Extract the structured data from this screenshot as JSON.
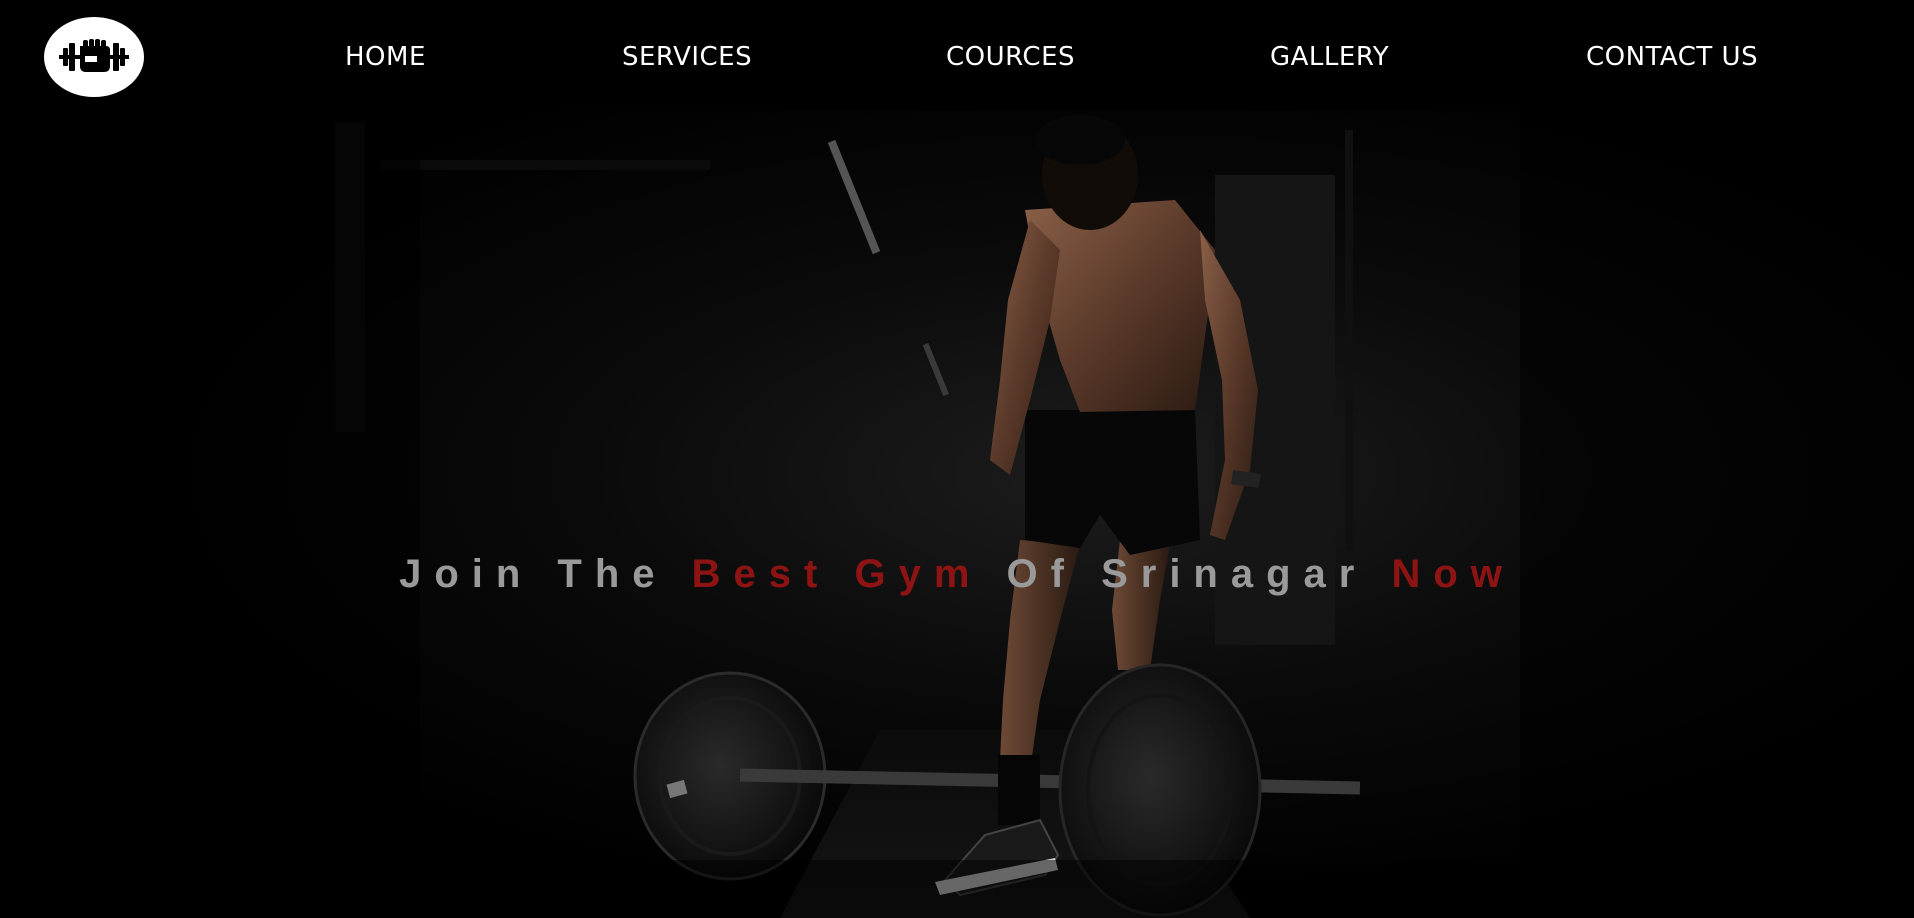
{
  "brand": {
    "logo_icon": "fist-dumbbell-icon"
  },
  "nav": {
    "items": [
      {
        "label": "HOME"
      },
      {
        "label": "SERVICES"
      },
      {
        "label": "COURCES"
      },
      {
        "label": "GALLERY"
      },
      {
        "label": "CONTACT US"
      }
    ]
  },
  "hero": {
    "headline_parts": [
      {
        "text": "Join The ",
        "style": "muted"
      },
      {
        "text": "Best Gym",
        "style": "accent"
      },
      {
        "text": " Of Srinagar ",
        "style": "muted"
      },
      {
        "text": "Now",
        "style": "accent"
      }
    ],
    "image": "bodybuilder-with-barbell-photo"
  },
  "colors": {
    "background": "#000000",
    "nav_text": "#ffffff",
    "headline_muted": "#9a9a9a",
    "headline_accent": "#8e1414"
  }
}
